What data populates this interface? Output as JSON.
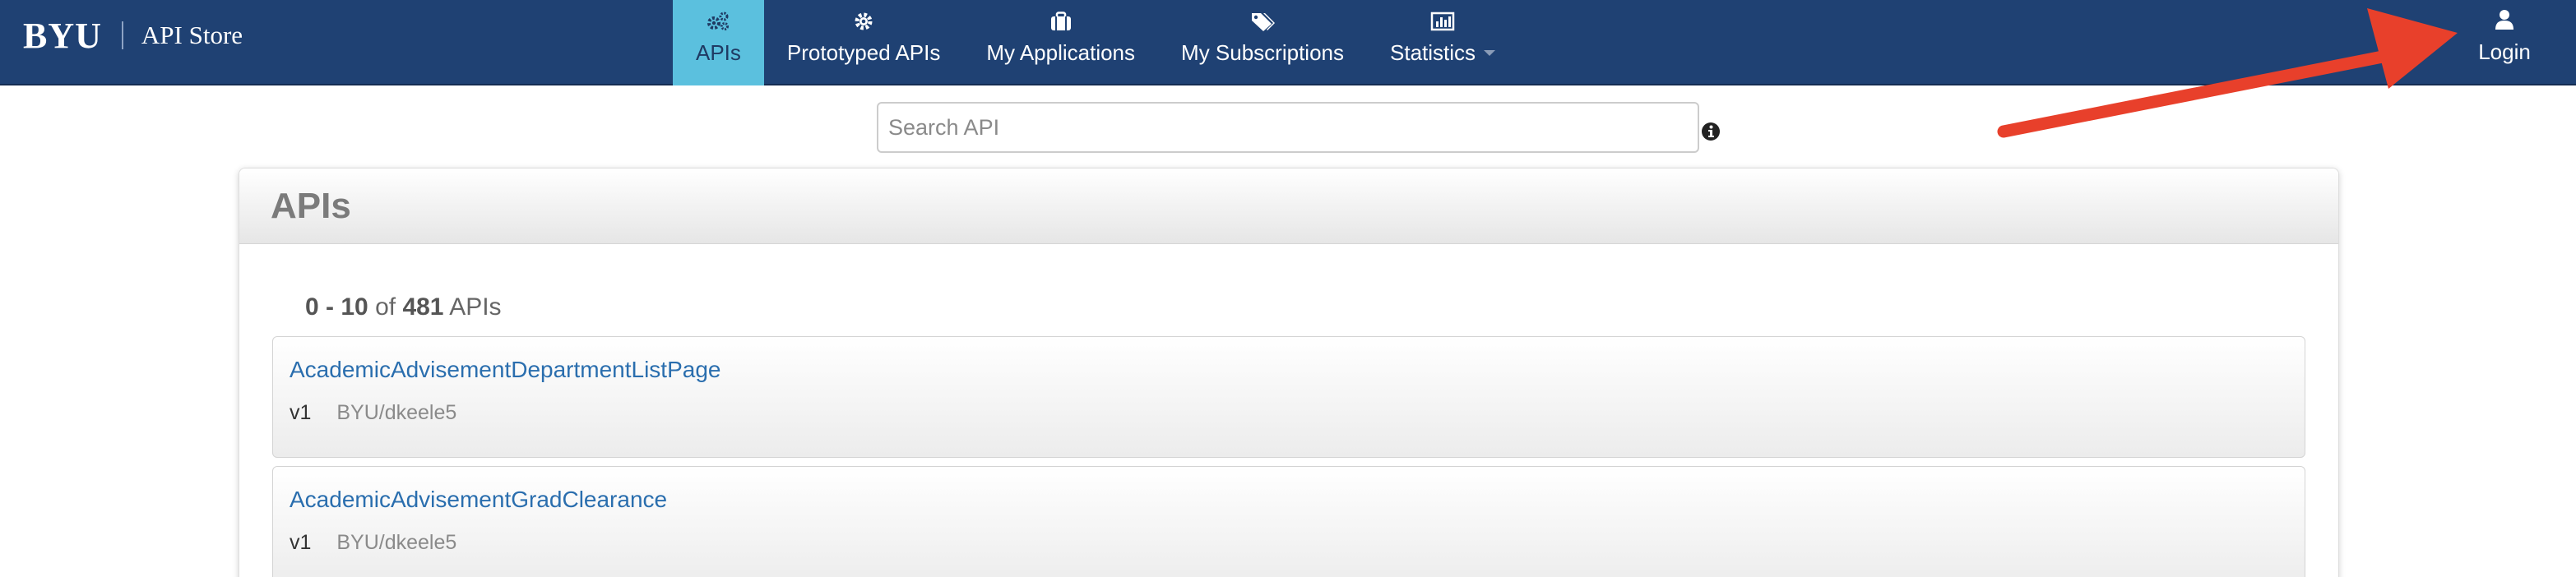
{
  "brand": {
    "logo": "BYU",
    "name": "API Store"
  },
  "nav": {
    "items": [
      {
        "label": "APIs",
        "icon": "gears-icon",
        "active": true
      },
      {
        "label": "Prototyped APIs",
        "icon": "gear-icon"
      },
      {
        "label": "My Applications",
        "icon": "briefcase-icon"
      },
      {
        "label": "My Subscriptions",
        "icon": "tags-icon"
      },
      {
        "label": "Statistics",
        "icon": "bar-chart-icon",
        "has_dropdown": true
      }
    ],
    "login": {
      "label": "Login",
      "icon": "user-icon"
    }
  },
  "search": {
    "placeholder": "Search API",
    "value": ""
  },
  "panel": {
    "title": "APIs",
    "range": "0 - 10",
    "of_text": "of",
    "total": "481",
    "unit": "APIs"
  },
  "apis": [
    {
      "name": "AcademicAdvisementDepartmentListPage",
      "version": "v1",
      "owner": "BYU/dkeele5"
    },
    {
      "name": "AcademicAdvisementGradClearance",
      "version": "v1",
      "owner": "BYU/dkeele5"
    }
  ],
  "colors": {
    "navbar": "#1f4173",
    "active_tab": "#5bc0de",
    "link": "#2a6eae",
    "annotation_arrow": "#e8402b"
  }
}
